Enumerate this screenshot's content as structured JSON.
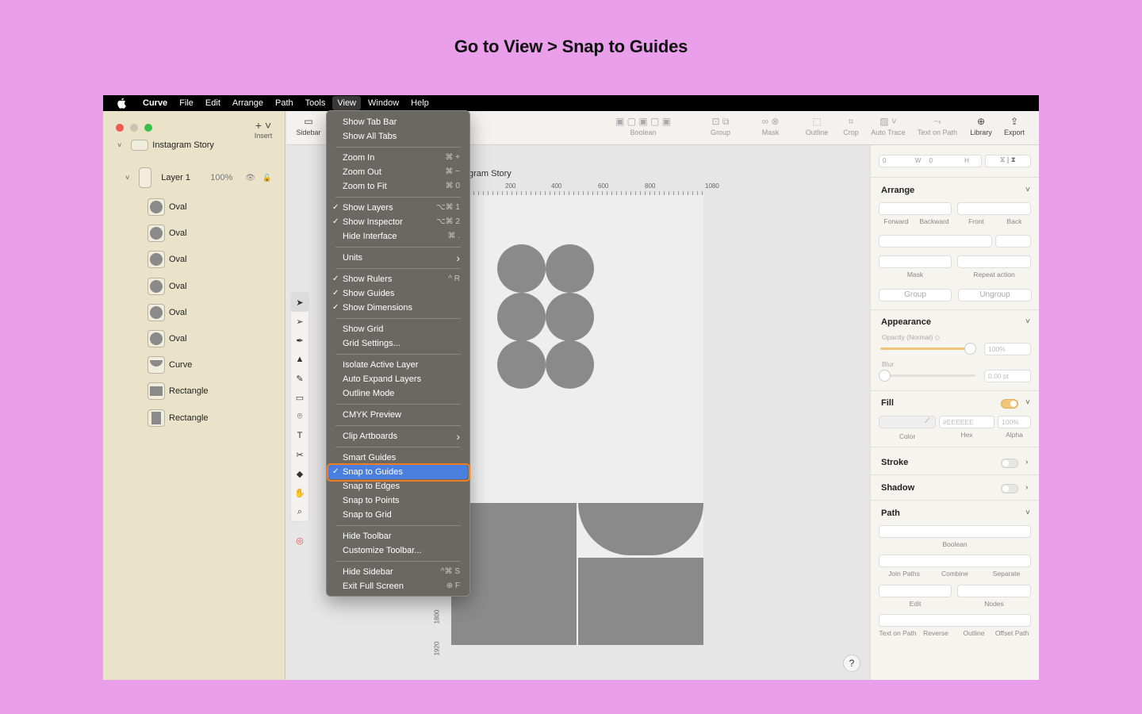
{
  "headline": "Go to View > Snap to Guides",
  "menubar": {
    "app": "Curve",
    "items": [
      "File",
      "Edit",
      "Arrange",
      "Path",
      "Tools",
      "View",
      "Window",
      "Help"
    ],
    "active": "View"
  },
  "sidebar": {
    "insert_label": "Insert",
    "top_item": "Instagram Story",
    "layer": {
      "name": "Layer 1",
      "opacity": "100%"
    },
    "layers": [
      {
        "name": "Oval",
        "kind": "oval"
      },
      {
        "name": "Oval",
        "kind": "oval"
      },
      {
        "name": "Oval",
        "kind": "oval"
      },
      {
        "name": "Oval",
        "kind": "oval"
      },
      {
        "name": "Oval",
        "kind": "oval"
      },
      {
        "name": "Oval",
        "kind": "oval"
      },
      {
        "name": "Curve",
        "kind": "curve"
      },
      {
        "name": "Rectangle",
        "kind": "rect"
      },
      {
        "name": "Rectangle",
        "kind": "rectv"
      }
    ]
  },
  "toolbar": {
    "sidebar": "Sidebar",
    "boolean": "Boolean",
    "group": "Group",
    "mask": "Mask",
    "outline": "Outline",
    "crop": "Crop",
    "auto_trace": "Auto Trace",
    "text_on_path": "Text on Path",
    "library": "Library",
    "export": "Export"
  },
  "canvas": {
    "artboard_label": "gram Story",
    "ruler_h": [
      "200",
      "400",
      "600",
      "800",
      "1080"
    ],
    "ruler_v": [
      "1800",
      "1920"
    ],
    "help": "?"
  },
  "inspector": {
    "dims": {
      "x": "0",
      "w_label": "W",
      "y": "0",
      "h_label": "H"
    },
    "arrange": {
      "title": "Arrange",
      "forward": "Forward",
      "backward": "Backward",
      "front": "Front",
      "back": "Back",
      "mask": "Mask",
      "repeat": "Repeat action",
      "group": "Group",
      "ungroup": "Ungroup"
    },
    "appearance": {
      "title": "Appearance",
      "opacity_label": "Opacity (Normal) ◇",
      "opacity": "100%",
      "blur_label": "Blur",
      "blur": "0.00 pt"
    },
    "fill": {
      "title": "Fill",
      "hex": "#EEEEEE",
      "alpha": "100%",
      "color_lbl": "Color",
      "hex_lbl": "Hex",
      "alpha_lbl": "Alpha"
    },
    "stroke": {
      "title": "Stroke"
    },
    "shadow": {
      "title": "Shadow"
    },
    "path": {
      "title": "Path",
      "boolean": "Boolean",
      "join": "Join Paths",
      "combine": "Combine",
      "separate": "Separate",
      "edit": "Edit",
      "nodes": "Nodes",
      "text_on_path": "Text on Path",
      "reverse": "Reverse",
      "outline": "Outline",
      "offset": "Offset Path"
    }
  },
  "view_menu": [
    {
      "label": "Show Tab Bar"
    },
    {
      "label": "Show All Tabs"
    },
    {
      "sep": true
    },
    {
      "label": "Zoom In",
      "shortcut": "⌘ +"
    },
    {
      "label": "Zoom Out",
      "shortcut": "⌘ −"
    },
    {
      "label": "Zoom to Fit",
      "shortcut": "⌘ 0"
    },
    {
      "sep": true
    },
    {
      "label": "Show Layers",
      "checked": true,
      "shortcut": "⌥⌘ 1"
    },
    {
      "label": "Show Inspector",
      "checked": true,
      "shortcut": "⌥⌘ 2"
    },
    {
      "label": "Hide Interface",
      "shortcut": "⌘ ."
    },
    {
      "sep": true
    },
    {
      "label": "Units",
      "submenu": true
    },
    {
      "sep": true
    },
    {
      "label": "Show Rulers",
      "checked": true,
      "shortcut": "^ R"
    },
    {
      "label": "Show Guides",
      "checked": true
    },
    {
      "label": "Show Dimensions",
      "checked": true
    },
    {
      "sep": true
    },
    {
      "label": "Show Grid"
    },
    {
      "label": "Grid Settings..."
    },
    {
      "sep": true
    },
    {
      "label": "Isolate Active Layer"
    },
    {
      "label": "Auto Expand Layers"
    },
    {
      "label": "Outline Mode"
    },
    {
      "sep": true
    },
    {
      "label": "CMYK Preview"
    },
    {
      "sep": true
    },
    {
      "label": "Clip Artboards",
      "submenu": true
    },
    {
      "sep": true
    },
    {
      "label": "Smart Guides"
    },
    {
      "label": "Snap to Guides",
      "checked": true,
      "highlighted": true
    },
    {
      "label": "Snap to Edges"
    },
    {
      "label": "Snap to Points"
    },
    {
      "label": "Snap to Grid"
    },
    {
      "sep": true
    },
    {
      "label": "Hide Toolbar"
    },
    {
      "label": "Customize Toolbar..."
    },
    {
      "sep": true
    },
    {
      "label": "Hide Sidebar",
      "shortcut": "^⌘ S"
    },
    {
      "label": "Exit Full Screen",
      "shortcut": "⊕ F"
    }
  ]
}
